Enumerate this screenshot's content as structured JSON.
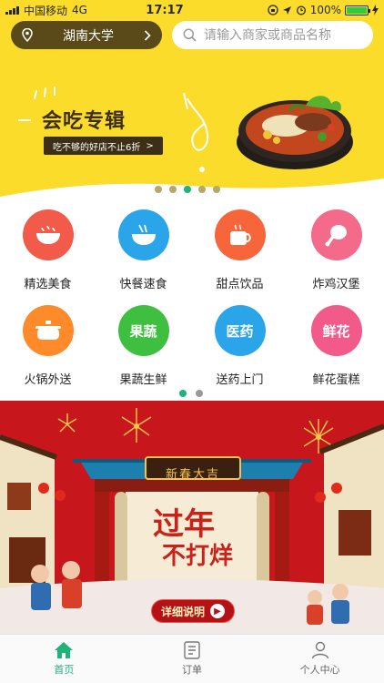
{
  "status_bar": {
    "carrier": "中国移动",
    "network": "4G",
    "time": "17:17",
    "battery": "100%"
  },
  "header": {
    "location": "湖南大学",
    "search_placeholder": "请输入商家或商品名称"
  },
  "hero_banner": {
    "title": "会吃专辑",
    "subtitle": "吃不够的好店不止6折",
    "arrow": ">",
    "dot_count": 5,
    "active_dot": 2,
    "colors": {
      "background": "#fbdc2b",
      "accent": "#3d2f15",
      "active_dot": "#1fb37a"
    }
  },
  "categories": [
    {
      "label": "精选美食",
      "icon": "bowl-icon",
      "color": "#f25a4a",
      "badge": ""
    },
    {
      "label": "快餐速食",
      "icon": "noodle-bowl-icon",
      "color": "#2aa5ea",
      "badge": ""
    },
    {
      "label": "甜点饮品",
      "icon": "coffee-cup-icon",
      "color": "#f6663a",
      "badge": ""
    },
    {
      "label": "炸鸡汉堡",
      "icon": "chicken-leg-icon",
      "color": "#f46a8a",
      "badge": ""
    },
    {
      "label": "火锅外送",
      "icon": "hotpot-icon",
      "color": "#ff8a2a",
      "badge": ""
    },
    {
      "label": "果蔬生鲜",
      "icon": "apple-icon",
      "color": "#3fbf3f",
      "badge": "果蔬"
    },
    {
      "label": "送药上门",
      "icon": "medicine-kit-icon",
      "color": "#2aa5ea",
      "badge": "医药"
    },
    {
      "label": "鲜花蛋糕",
      "icon": "flower-icon",
      "color": "#f25a8a",
      "badge": "鲜花"
    }
  ],
  "grid_pager": {
    "dot_count": 2,
    "active_dot": 0
  },
  "promo_banner": {
    "sign": "新春大吉",
    "headline_line1": "过年",
    "headline_line2": "不打烊",
    "button_label": "详细说明",
    "colors": {
      "background": "#c8171c",
      "gold": "#f5c54a"
    }
  },
  "tabbar": {
    "tabs": [
      {
        "label": "首页",
        "icon": "home-icon",
        "active": true
      },
      {
        "label": "订单",
        "icon": "order-list-icon",
        "active": false
      },
      {
        "label": "个人中心",
        "icon": "user-icon",
        "active": false
      }
    ],
    "active_color": "#1fb37a"
  }
}
